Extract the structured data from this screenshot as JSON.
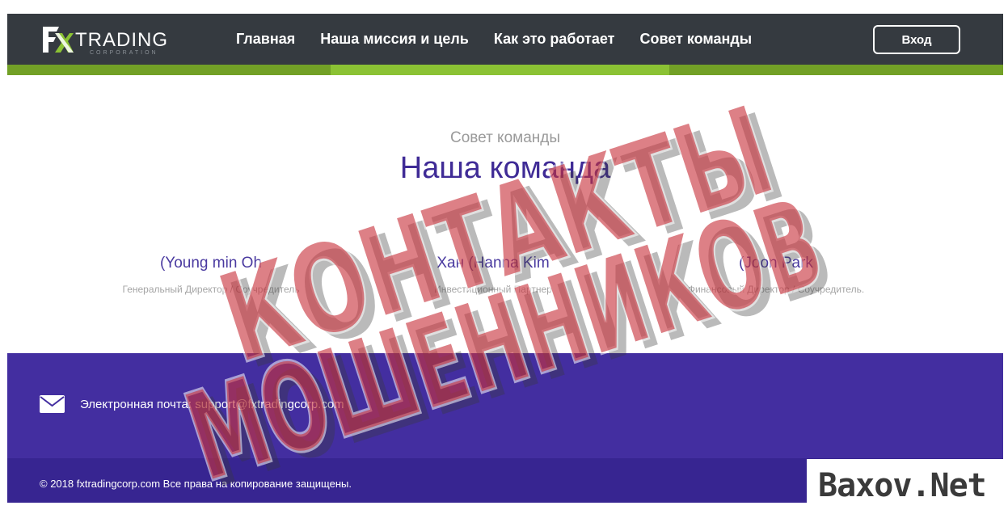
{
  "header": {
    "logo": {
      "name": "TRADING",
      "subtitle": "CORPORATION"
    },
    "nav": [
      {
        "label": "Главная"
      },
      {
        "label": "Наша миссия и цель"
      },
      {
        "label": "Как это работает"
      },
      {
        "label": "Совет команды"
      }
    ],
    "login_label": "Вход"
  },
  "team": {
    "subtitle": "Совет команды",
    "title": "Наша команда",
    "members": [
      {
        "name": "(Young min Oh",
        "role": "Генеральный Директор / Соучредитель"
      },
      {
        "name": "Хан (Hanna Kim",
        "role": "Инвестиционный Партнер"
      },
      {
        "name": "(Joon Park",
        "role": "Финансовый Директор / Соучредитель."
      }
    ]
  },
  "footer": {
    "email_label": "Электронная почта: ",
    "email": "support@fxtradingcorp.com",
    "copyright": "© 2018 fxtradingcorp.com Все права на копирование защищены."
  },
  "watermark": {
    "line1": "КОНТАКТЫ",
    "line2": "МОШЕННИКОВ",
    "site": "Baxov.Net"
  },
  "colors": {
    "header_bg": "#353a40",
    "accent_green": "#8bc234",
    "brand_purple": "#432ea0",
    "stamp_red": "#c8323c"
  }
}
